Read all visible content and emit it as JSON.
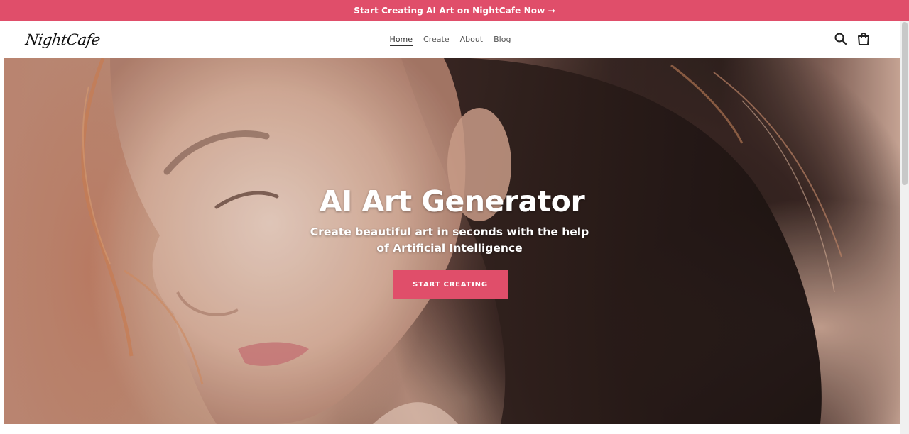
{
  "announcement": {
    "text": "Start Creating AI Art on NightCafe Now →"
  },
  "header": {
    "logo_text": "NightCafe",
    "nav": [
      {
        "label": "Home",
        "active": true
      },
      {
        "label": "Create",
        "active": false
      },
      {
        "label": "About",
        "active": false
      },
      {
        "label": "Blog",
        "active": false
      }
    ],
    "icons": [
      "search-icon",
      "cart-icon"
    ]
  },
  "hero": {
    "title": "AI Art Generator",
    "subtitle": "Create beautiful art in seconds with the help of Artificial Intelligence",
    "cta_label": "START CREATING"
  },
  "colors": {
    "accent": "#e04e6a",
    "header_bg": "#ffffff",
    "hero_text": "#ffffff"
  }
}
